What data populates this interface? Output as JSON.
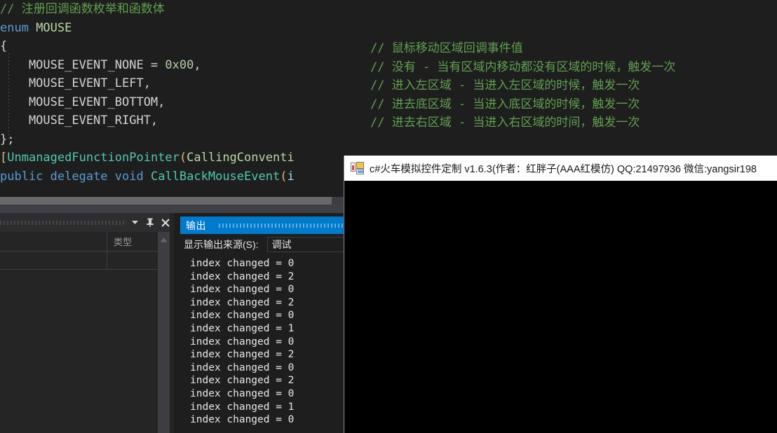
{
  "editor": {
    "left_lines": [
      [
        {
          "t": "// 注册回调函数枚举和函数体",
          "c": "cm"
        }
      ],
      [
        {
          "t": "enum ",
          "c": "kw"
        },
        {
          "t": "MOUSE",
          "c": "ty"
        }
      ],
      [
        {
          "t": "{",
          "c": "pl"
        }
      ],
      [
        {
          "t": "    MOUSE_EVENT_NONE = ",
          "c": "pl"
        },
        {
          "t": "0x00",
          "c": "num"
        },
        {
          "t": ",",
          "c": "pl"
        }
      ],
      [
        {
          "t": "    MOUSE_EVENT_LEFT,",
          "c": "pl"
        }
      ],
      [
        {
          "t": "    MOUSE_EVENT_BOTTOM,",
          "c": "pl"
        }
      ],
      [
        {
          "t": "    MOUSE_EVENT_RIGHT,",
          "c": "pl"
        }
      ],
      [
        {
          "t": "};",
          "c": "pl"
        }
      ],
      [
        {
          "t": "[",
          "c": "brk"
        },
        {
          "t": "UnmanagedFunctionPointer",
          "c": "tyg"
        },
        {
          "t": "(",
          "c": "brk"
        },
        {
          "t": "CallingConventi",
          "c": "ty"
        }
      ],
      [
        {
          "t": "public ",
          "c": "kw"
        },
        {
          "t": "delegate ",
          "c": "kw"
        },
        {
          "t": "void ",
          "c": "kw"
        },
        {
          "t": "CallBackMouseEvent",
          "c": "tyg"
        },
        {
          "t": "(",
          "c": "brk"
        },
        {
          "t": "i",
          "c": "id"
        }
      ]
    ],
    "right_comment_lines": [
      "// 鼠标移动区域回调事件值",
      "// 没有 - 当有区域内移动都没有区域的时候，触发一次",
      "// 进入左区域 - 当进入左区域的时候，触发一次",
      "// 进去底区域 - 当进入底区域的时候，触发一次",
      "// 进去右区域 - 当进入右区域的时间，触发一次"
    ]
  },
  "tool_window": {
    "header_buttons": [
      {
        "name": "dropdown",
        "glyph": "▼"
      },
      {
        "name": "pin",
        "glyph": "pin"
      },
      {
        "name": "close",
        "glyph": "✕"
      }
    ],
    "columns": [
      "",
      "类型"
    ]
  },
  "output": {
    "tab_label": "输出",
    "source_label": "显示输出来源(S):",
    "source_value": "调试",
    "log_lines": [
      "index changed = 0",
      "index changed = 2",
      "index changed = 0",
      "index changed = 2",
      "index changed = 0",
      "index changed = 1",
      "index changed = 0",
      "index changed = 2",
      "index changed = 0",
      "index changed = 2",
      "index changed = 0",
      "index changed = 1",
      "index changed = 0"
    ]
  },
  "app_window": {
    "title": "c#火车模拟控件定制 v1.6.3(作者：红胖子(AAA红模仿) QQ:21497936 微信:yangsir198",
    "icon": "app-window-icon"
  },
  "colors": {
    "editor_bg": "#1e1e1e",
    "comment_green": "#5fa04e",
    "keyword_blue": "#569cd6",
    "type_green": "#4ec9b0",
    "accent_blue": "#007acc",
    "panel_bg": "#252526"
  }
}
